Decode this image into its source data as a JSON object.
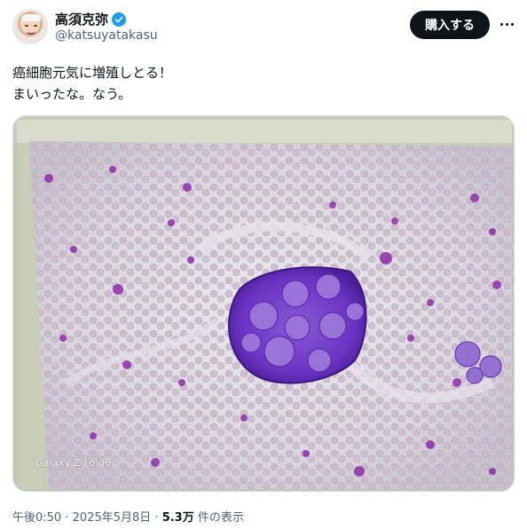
{
  "author": {
    "display_name": "高須克弥",
    "handle": "@katsuyatakasu",
    "verified": true
  },
  "header": {
    "buy_label": "購入する",
    "more_icon": "more-horizontal-icon"
  },
  "tweet": {
    "lines": [
      "癌細胞元気に増殖しとる！",
      "まいったな。なう。"
    ]
  },
  "media": {
    "watermark": "Galaxy Z Fold6"
  },
  "meta": {
    "time": "午後0:50",
    "separator": "·",
    "date": "2025年5月8日",
    "views_count": "5.3万",
    "views_label": "件の表示"
  },
  "colors": {
    "accent": "#1d9bf0",
    "text_primary": "#0f1419",
    "text_secondary": "#536471",
    "button_bg": "#0f1419",
    "stain_purple": "#7b3fbf"
  }
}
